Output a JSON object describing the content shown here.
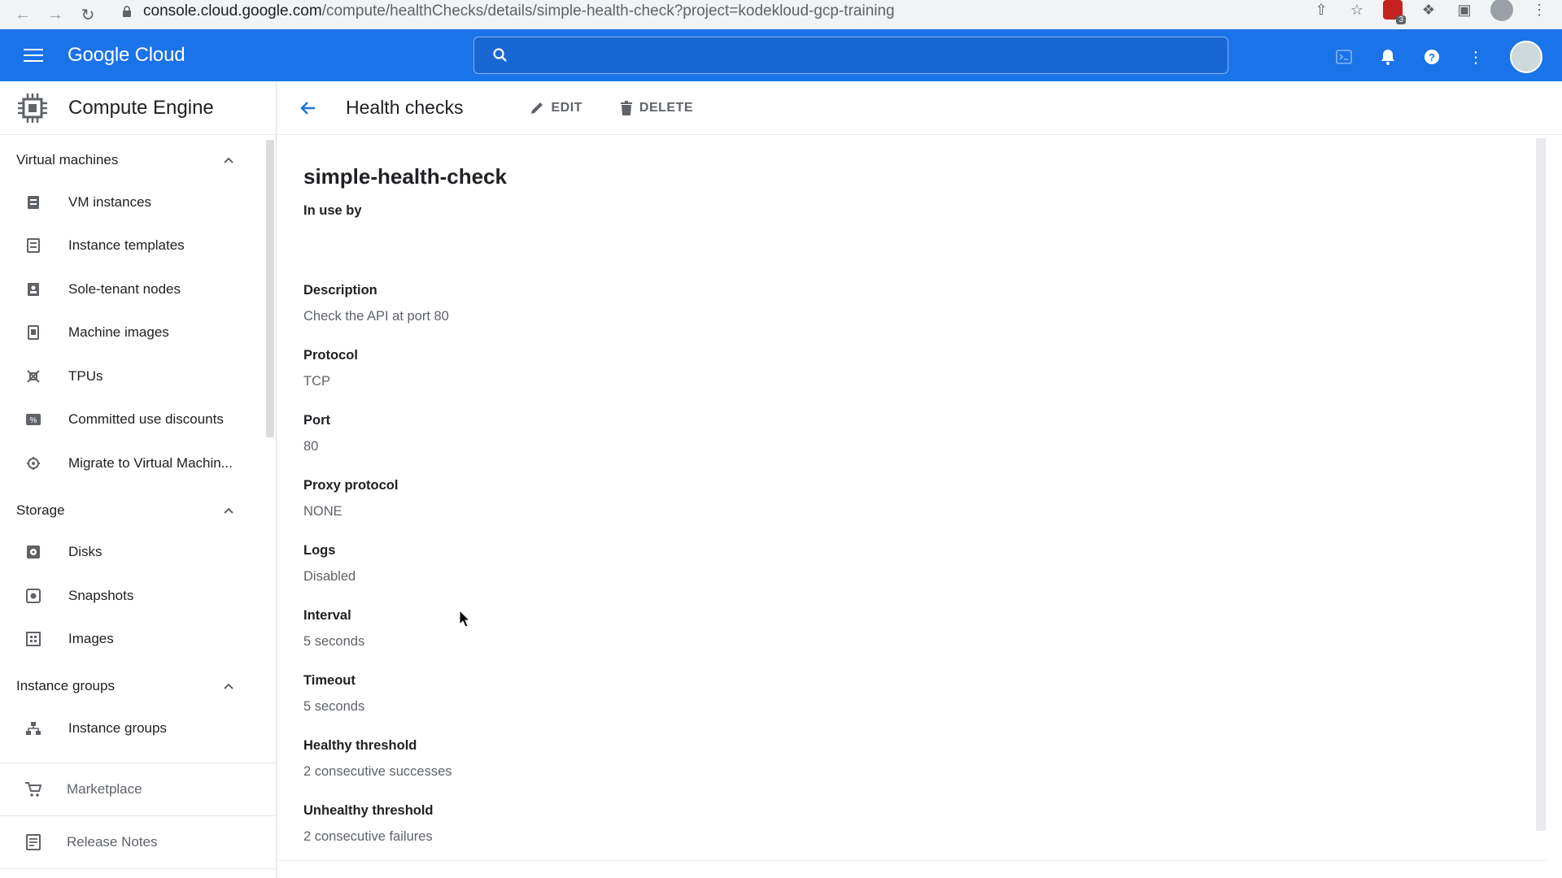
{
  "browser": {
    "url_host": "console.cloud.google.com",
    "url_path": "/compute/healthChecks/details/simple-health-check?project=kodekloud-gcp-training",
    "extension_badge": "3"
  },
  "topbar": {
    "logo": "Google Cloud",
    "search_placeholder": ""
  },
  "sidebar": {
    "product_title": "Compute Engine",
    "sections": [
      {
        "title": "Virtual machines",
        "items": [
          {
            "label": "VM instances",
            "icon": "vm-instances-icon"
          },
          {
            "label": "Instance templates",
            "icon": "instance-templates-icon"
          },
          {
            "label": "Sole-tenant nodes",
            "icon": "sole-tenant-icon"
          },
          {
            "label": "Machine images",
            "icon": "machine-images-icon"
          },
          {
            "label": "TPUs",
            "icon": "tpu-icon"
          },
          {
            "label": "Committed use discounts",
            "icon": "discount-icon"
          },
          {
            "label": "Migrate to Virtual Machin...",
            "icon": "migrate-icon"
          }
        ]
      },
      {
        "title": "Storage",
        "items": [
          {
            "label": "Disks",
            "icon": "disk-icon"
          },
          {
            "label": "Snapshots",
            "icon": "snapshot-icon"
          },
          {
            "label": "Images",
            "icon": "images-icon"
          }
        ]
      },
      {
        "title": "Instance groups",
        "items": [
          {
            "label": "Instance groups",
            "icon": "instance-groups-icon"
          }
        ]
      }
    ],
    "bottom": [
      {
        "label": "Marketplace",
        "icon": "cart-icon"
      },
      {
        "label": "Release Notes",
        "icon": "release-notes-icon"
      }
    ]
  },
  "header": {
    "title": "Health checks",
    "edit_label": "EDIT",
    "delete_label": "DELETE"
  },
  "details": {
    "name": "simple-health-check",
    "in_use_by_label": "In use by",
    "fields": [
      {
        "label": "Description",
        "value": "Check the API at port 80"
      },
      {
        "label": "Protocol",
        "value": "TCP"
      },
      {
        "label": "Port",
        "value": "80"
      },
      {
        "label": "Proxy protocol",
        "value": "NONE"
      },
      {
        "label": "Logs",
        "value": "Disabled"
      },
      {
        "label": "Interval",
        "value": "5 seconds"
      },
      {
        "label": "Timeout",
        "value": "5 seconds"
      },
      {
        "label": "Healthy threshold",
        "value": "2 consecutive successes"
      },
      {
        "label": "Unhealthy threshold",
        "value": "2 consecutive failures"
      }
    ]
  },
  "colors": {
    "brand_blue": "#1a73e8",
    "text_primary": "#202124",
    "text_secondary": "#5f6368"
  }
}
